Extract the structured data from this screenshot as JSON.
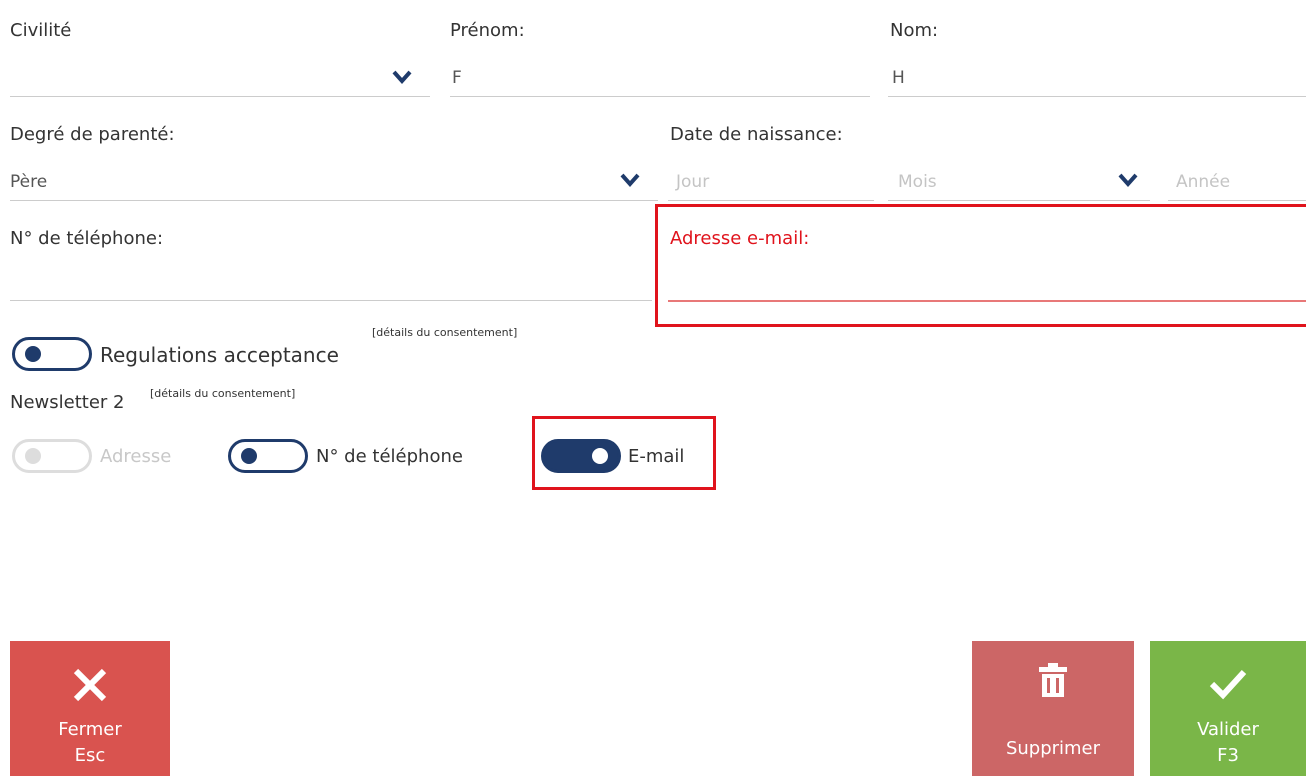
{
  "fields": {
    "civilite": {
      "label": "Civilité",
      "value": ""
    },
    "prenom": {
      "label": "Prénom:",
      "value": "F"
    },
    "nom": {
      "label": "Nom:",
      "value": "H"
    },
    "parente": {
      "label": "Degré de parenté:",
      "value": "Père"
    },
    "naissance": {
      "label": "Date de naissance:",
      "jour": "Jour",
      "mois": "Mois",
      "annee": "Année"
    },
    "telephone": {
      "label": "N° de téléphone:",
      "value": ""
    },
    "email": {
      "label": "Adresse e-mail:",
      "value": ""
    }
  },
  "consents": {
    "regulations": {
      "label": "Regulations acceptance",
      "details": "[détails du consentement]",
      "checked": false
    },
    "newsletter": {
      "label": "Newsletter 2",
      "details": "[détails du consentement]",
      "channels": [
        {
          "label": "Adresse",
          "checked": false,
          "disabled": true
        },
        {
          "label": "N° de téléphone",
          "checked": false,
          "disabled": false
        },
        {
          "label": "E-mail",
          "checked": true,
          "disabled": false
        }
      ]
    }
  },
  "buttons": {
    "close": {
      "label": "Fermer",
      "shortcut": "Esc",
      "icon": "close-x-icon",
      "color": "#d9534f"
    },
    "delete": {
      "label": "Supprimer",
      "icon": "trash-icon",
      "color": "#cc6666"
    },
    "validate": {
      "label": "Valider",
      "shortcut": "F3",
      "icon": "checkmark-icon",
      "color": "#7ab648"
    }
  },
  "colors": {
    "accent": "#1f3b6b",
    "error": "#e0131c",
    "highlight": "#e0131c"
  }
}
